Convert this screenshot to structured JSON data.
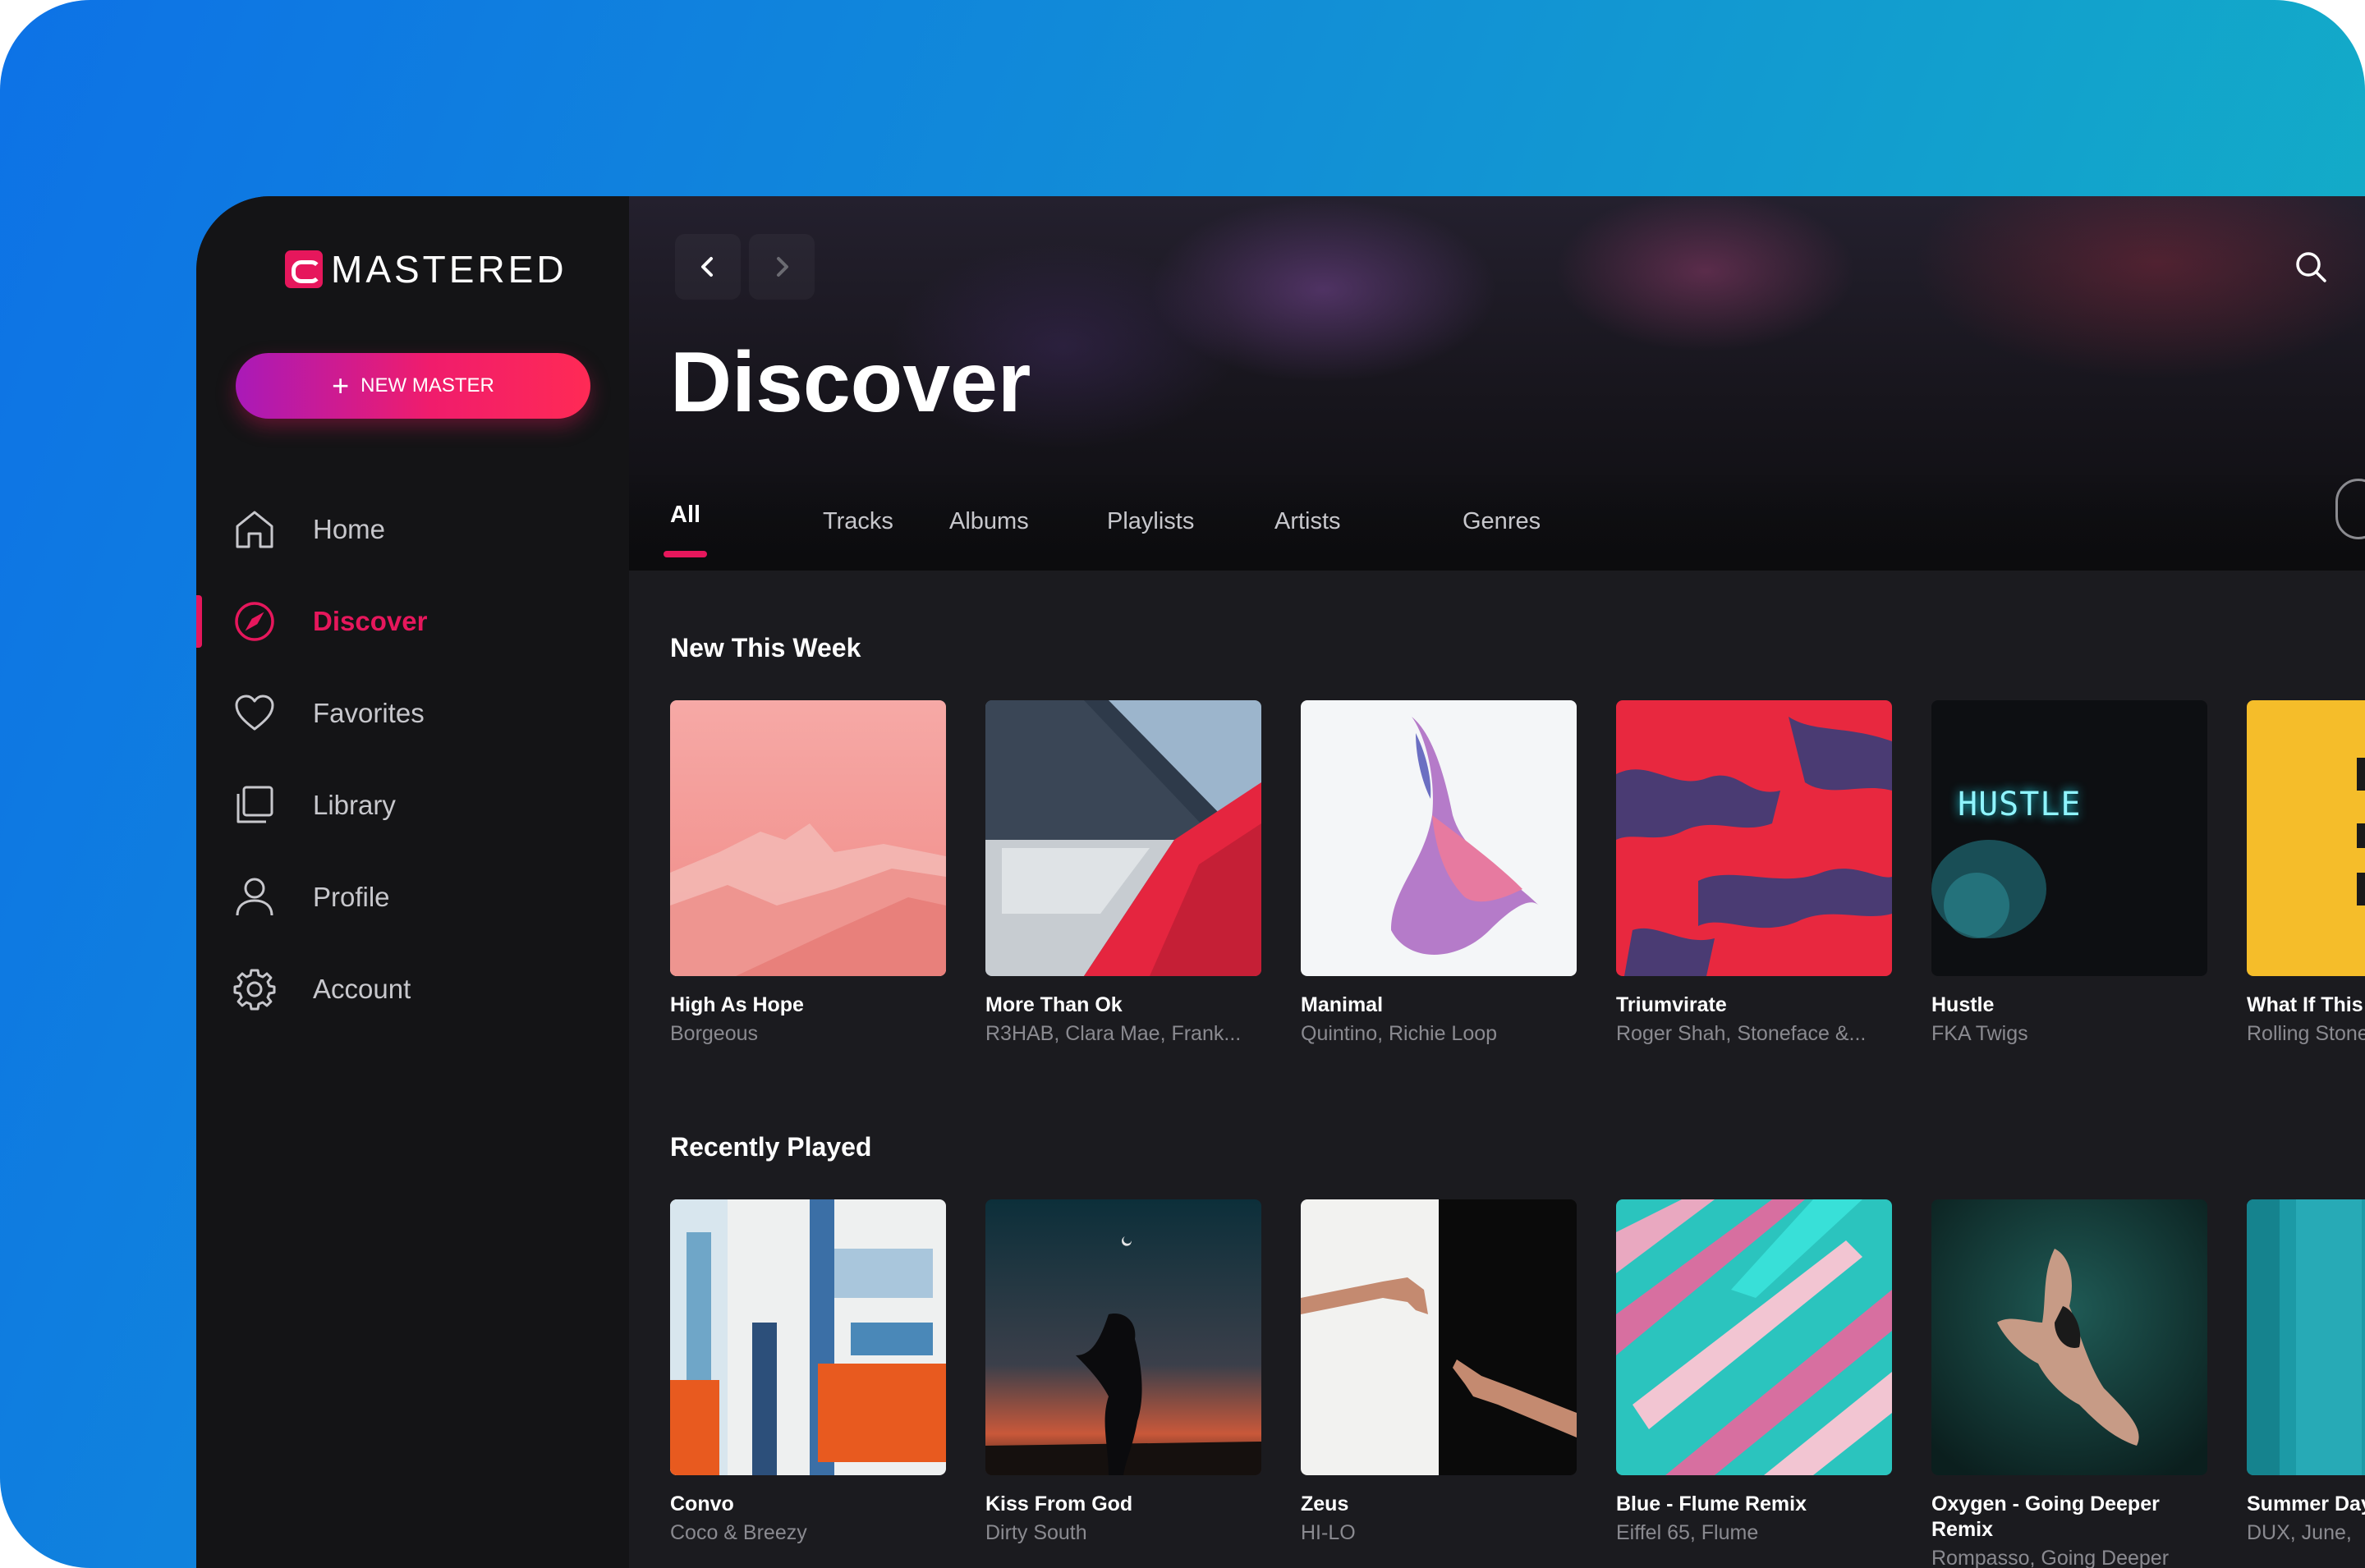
{
  "app": {
    "logo_text": "MASTERED",
    "accent_color": "#e6175c",
    "new_button_label": "NEW MASTER"
  },
  "sidebar": {
    "items": [
      {
        "label": "Home",
        "icon": "home-icon",
        "active": false
      },
      {
        "label": "Discover",
        "icon": "compass-icon",
        "active": true
      },
      {
        "label": "Favorites",
        "icon": "heart-icon",
        "active": false
      },
      {
        "label": "Library",
        "icon": "library-icon",
        "active": false
      },
      {
        "label": "Profile",
        "icon": "user-icon",
        "active": false
      },
      {
        "label": "Account",
        "icon": "gear-icon",
        "active": false
      }
    ]
  },
  "header": {
    "title": "Discover",
    "tabs": [
      "All",
      "Tracks",
      "Albums",
      "Playlists",
      "Artists",
      "Genres"
    ],
    "active_tab": "All"
  },
  "sections": {
    "new_this_week": {
      "title": "New This Week",
      "items": [
        {
          "title": "High As Hope",
          "subtitle": "Borgeous"
        },
        {
          "title": "More Than Ok",
          "subtitle": "R3HAB, Clara Mae, Frank..."
        },
        {
          "title": "Manimal",
          "subtitle": "Quintino, Richie Loop"
        },
        {
          "title": "Triumvirate",
          "subtitle": "Roger Shah, Stoneface &..."
        },
        {
          "title": "Hustle",
          "subtitle": "FKA Twigs",
          "art_text": "HUSTLE"
        },
        {
          "title": "What If This",
          "subtitle": "Rolling Stone"
        }
      ]
    },
    "recently_played": {
      "title": "Recently Played",
      "items": [
        {
          "title": "Convo",
          "subtitle": "Coco & Breezy"
        },
        {
          "title": "Kiss From God",
          "subtitle": "Dirty South"
        },
        {
          "title": "Zeus",
          "subtitle": "HI-LO"
        },
        {
          "title": "Blue - Flume Remix",
          "subtitle": "Eiffel 65, Flume"
        },
        {
          "title": "Oxygen - Going Deeper Remix",
          "subtitle": "Rompasso, Going Deeper"
        },
        {
          "title": "Summer Days",
          "subtitle": "DUX, June,"
        }
      ]
    }
  }
}
